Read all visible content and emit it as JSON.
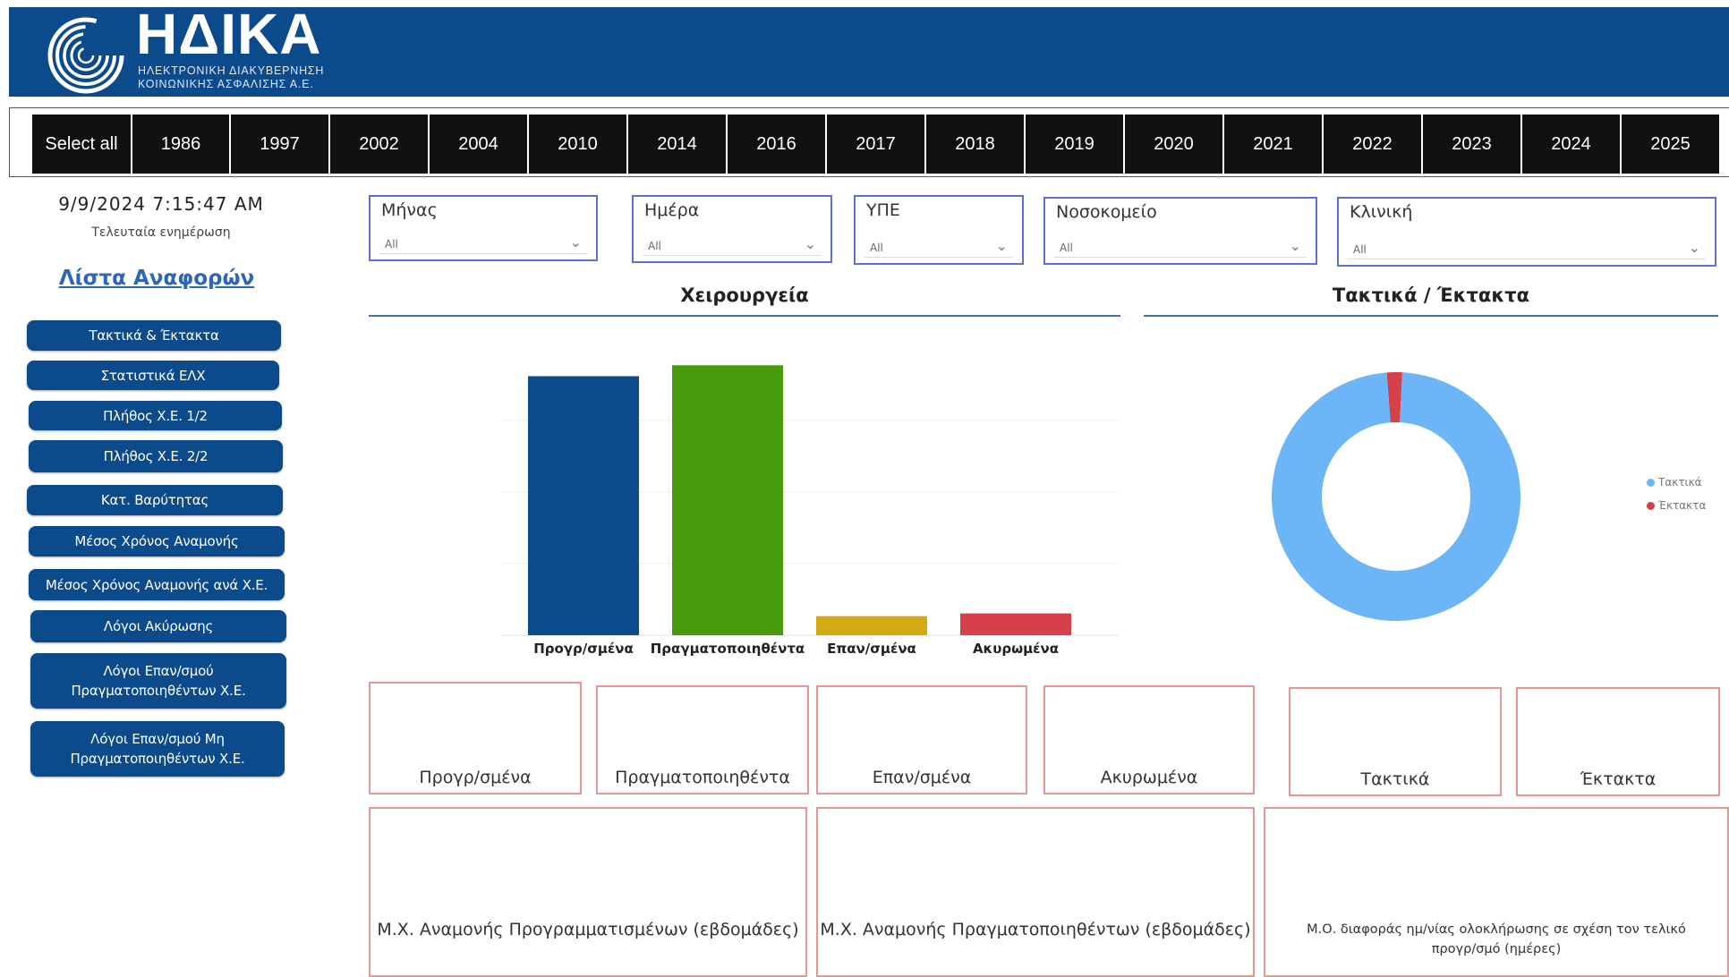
{
  "header": {
    "logo_title": "ΗΔΙΚΑ",
    "logo_sub_line1": "ΗΛΕΚΤΡΟΝΙΚΗ ΔΙΑΚΥΒΕΡΝΗΣΗ",
    "logo_sub_line2": "ΚΟΙΝΩΝΙΚΗΣ ΑΣΦΑΛΙΣΗΣ Α.Ε."
  },
  "years": [
    "Select all",
    "1986",
    "1997",
    "2002",
    "2004",
    "2010",
    "2014",
    "2016",
    "2017",
    "2018",
    "2019",
    "2020",
    "2021",
    "2022",
    "2023",
    "2024",
    "2025"
  ],
  "sidebar": {
    "datetime": "9/9/2024 7:15:47 AM",
    "datetime_label": "Τελευταία ενημέρωση",
    "reports_link": "Λίστα Αναφορών",
    "buttons": [
      "Τακτικά & Έκτακτα",
      "Στατιστικά ΕΛΧ",
      "Πλήθος Χ.Ε. 1/2",
      "Πλήθος Χ.Ε. 2/2",
      "Κατ. Βαρύτητας",
      "Μέσος Χρόνος Αναμονής",
      "Μέσος Χρόνος Αναμονής ανά Χ.Ε.",
      "Λόγοι Ακύρωσης",
      "Λόγοι Επαν/σμού Πραγματοποιηθέντων Χ.Ε.",
      "Λόγοι Επαν/σμού Μη Πραγματοποιηθέντων Χ.Ε."
    ]
  },
  "filters": [
    {
      "label": "Μήνας",
      "value": "All"
    },
    {
      "label": "Ημέρα",
      "value": "All"
    },
    {
      "label": "ΥΠΕ",
      "value": "All"
    },
    {
      "label": "Νοσοκομείο",
      "value": "All"
    },
    {
      "label": "Κλινική",
      "value": "All"
    }
  ],
  "cards_top": [
    "Προγρ/σμένα",
    "Πραγματοποιηθέντα",
    "Επαν/σμένα",
    "Ακυρωμένα",
    "Τακτικά",
    "Έκτακτα"
  ],
  "cards_bottom": [
    "Μ.Χ. Αναμονής Προγραμματισμένων (εβδομάδες)",
    "Μ.Χ. Αναμονής Πραγματοποιηθέντων (εβδομάδες)",
    "Μ.Ο. διαφοράς ημ/νίας ολοκλήρωσης σε σχέση τον τελικό προγρ/σμό (ημέρες)"
  ],
  "chart_data": [
    {
      "type": "bar",
      "title": "Χειρουργεία",
      "categories": [
        "Προγρ/σμένα",
        "Πραγματοποιηθέντα",
        "Επαν/σμένα",
        "Ακυρωμένα"
      ],
      "values": [
        95,
        99,
        7,
        8
      ],
      "colors": [
        "#0b4a8b",
        "#4a9a0e",
        "#d4aa12",
        "#d5404a"
      ],
      "xlabel": "",
      "ylabel": "",
      "ylim": [
        0,
        105
      ],
      "grid": true
    },
    {
      "type": "pie",
      "subtype": "donut",
      "title": "Τακτικά / Έκτακτα",
      "labels": [
        "Τακτικά",
        "Έκτακτα"
      ],
      "values": [
        98,
        2
      ],
      "colors": [
        "#6cb6f8",
        "#d5404a"
      ],
      "legend": "right"
    }
  ]
}
